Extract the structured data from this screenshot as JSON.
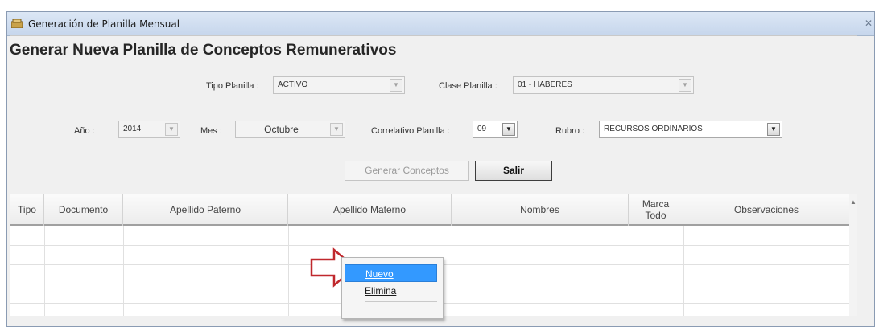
{
  "window": {
    "title": "Generación de Planilla Mensual",
    "close_glyph": "✕"
  },
  "form": {
    "heading": "Generar Nueva Planilla de Conceptos Remunerativos",
    "tipo_planilla": {
      "label": "Tipo Planilla :",
      "value": "ACTIVO"
    },
    "clase_planilla": {
      "label": "Clase Planilla :",
      "value": "01 - HABERES"
    },
    "anio": {
      "label": "Año :",
      "value": "2014"
    },
    "mes": {
      "label": "Mes :",
      "value": "Octubre"
    },
    "correlativo": {
      "label": "Correlativo Planilla :",
      "value": "09"
    },
    "rubro": {
      "label": "Rubro :",
      "value": "RECURSOS ORDINARIOS"
    },
    "buttons": {
      "generar": "Generar Conceptos",
      "salir": "Salir"
    }
  },
  "grid": {
    "columns": [
      "Tipo",
      "Documento",
      "Apellido Paterno",
      "Apellido Materno",
      "Nombres",
      "Marca Todo",
      "Observaciones"
    ]
  },
  "context_menu": {
    "items": [
      "Nuevo",
      "Elimina"
    ],
    "selected": "Nuevo"
  },
  "annotation": {
    "arrow_color": "#c0282d"
  },
  "icons": {
    "app": "window-app-icon",
    "dropdown": "chevron-down-icon"
  }
}
